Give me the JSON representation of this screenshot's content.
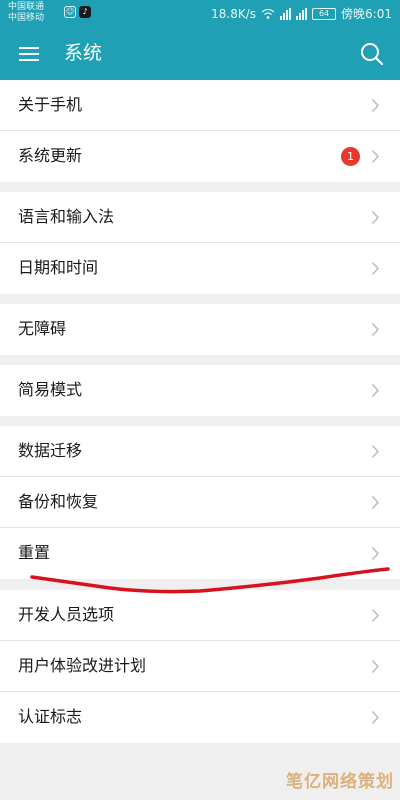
{
  "status_bar": {
    "carrier1": "中国联通",
    "carrier2": "中国移动",
    "app_icon_1": "☺",
    "app_icon_2": "♪",
    "net_speed": "18.8K/s",
    "battery": "64",
    "time": "傍晚6:01"
  },
  "header": {
    "title": "系统",
    "menu_icon": "menu-icon",
    "search_icon": "search-icon"
  },
  "sections": [
    {
      "items": [
        {
          "label": "关于手机"
        },
        {
          "label": "系统更新",
          "badge": "1"
        }
      ]
    },
    {
      "items": [
        {
          "label": "语言和输入法"
        },
        {
          "label": "日期和时间"
        }
      ]
    },
    {
      "items": [
        {
          "label": "无障碍"
        }
      ]
    },
    {
      "items": [
        {
          "label": "简易模式"
        }
      ]
    },
    {
      "items": [
        {
          "label": "数据迁移"
        },
        {
          "label": "备份和恢复"
        },
        {
          "label": "重置"
        }
      ]
    },
    {
      "items": [
        {
          "label": "开发人员选项"
        },
        {
          "label": "用户体验改进计划"
        },
        {
          "label": "认证标志"
        }
      ]
    }
  ],
  "watermark": "笔亿网络策划",
  "colors": {
    "header": "#1fa0b4",
    "badge": "#e6392d",
    "annotation": "#d7121e"
  }
}
